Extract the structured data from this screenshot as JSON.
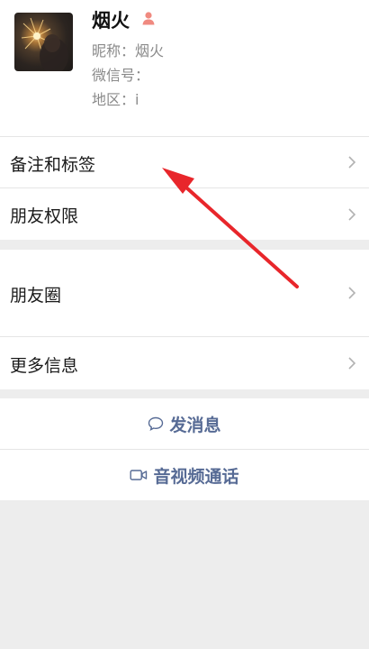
{
  "profile": {
    "name": "烟火",
    "nickname_line": "昵称：烟火",
    "wechat_id_line": "微信号：",
    "region_line": "地区：i",
    "gender_icon": "female-person-icon"
  },
  "rows": {
    "remark_tags": "备注和标签",
    "friend_permissions": "朋友权限",
    "moments": "朋友圈",
    "more_info": "更多信息"
  },
  "actions": {
    "send_message": "发消息",
    "send_message_icon": "chat-bubble-icon",
    "video_call": "音视频通话",
    "video_call_icon": "video-camera-icon"
  },
  "colors": {
    "background": "#ededed",
    "link_blue": "#576b95",
    "annotation_red": "#e8262b",
    "chevron": "#b2b2b2"
  }
}
